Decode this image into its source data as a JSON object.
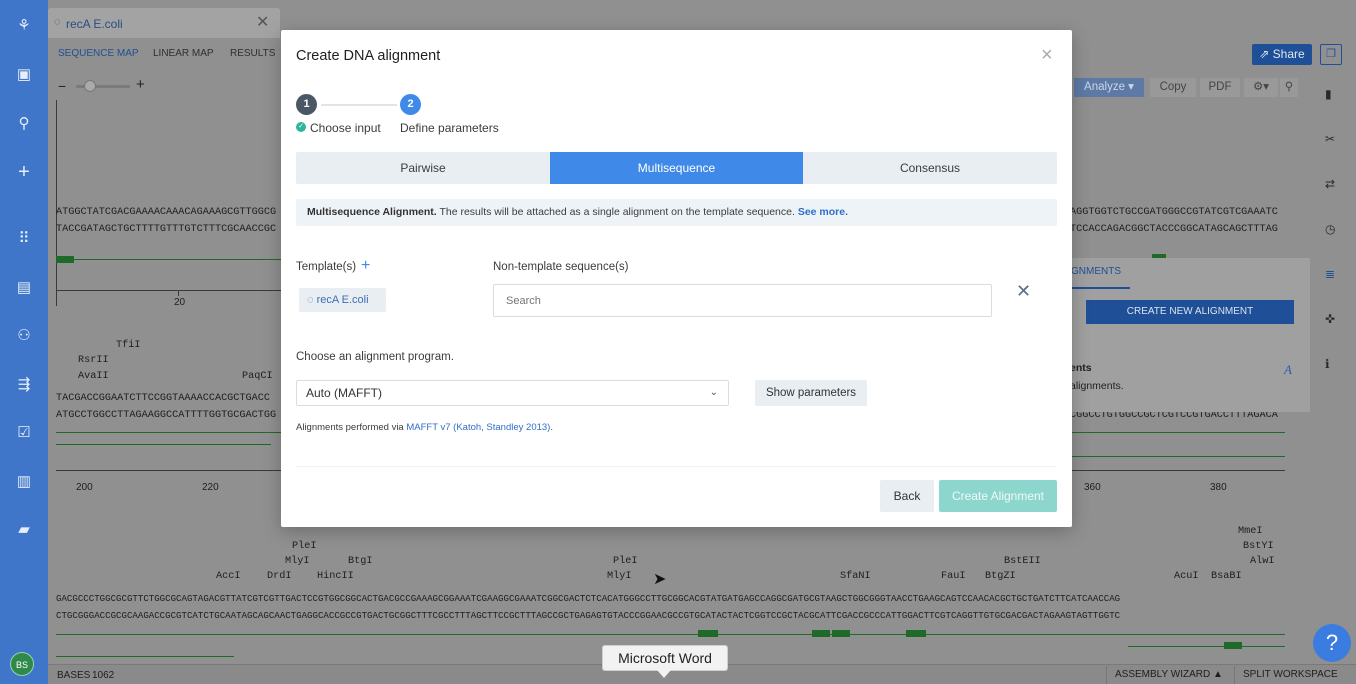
{
  "nav": {
    "avatar": "BS",
    "icons": [
      "jellyfish-logo-icon",
      "briefcase-icon",
      "search-icon",
      "plus-icon",
      "apps-grid-icon",
      "notebook-icon",
      "hierarchy-icon",
      "workflow-icon",
      "clipboard-icon",
      "chart-icon",
      "folder-icon"
    ]
  },
  "document": {
    "tab_title": "recA E.coli",
    "tab_close": "✕",
    "subnav": [
      "SEQUENCE MAP",
      "LINEAR MAP",
      "RESULTS"
    ],
    "share_label": "Share",
    "toolbar": {
      "analyze": "Analyze ▾",
      "copy": "Copy",
      "pdf": "PDF"
    },
    "seq_top_1": "ATGGCTATCGACGAAAACAAACAGAAAGCGTTGGCG",
    "seq_top_2": "TACCGATAGCTGCTTTTGTTTGTCTTTCGCAACCGC",
    "seq_top_r1": "AGGTGGTCTGCCGATGGGCCGTATCGTCGAAATC",
    "seq_top_r2": "TCCACCAGACGGCTACCCGGCATAGCAGCTTTAG",
    "num_20": "20",
    "enz_tfii": "TfiI",
    "enz_rsrii": "RsrII",
    "enz_avaii": "AvaII",
    "enz_paqci": "PaqCI",
    "seq_mid_1": "TACGACCGGAATCTTCCGGTAAAACCACGCTGACC",
    "seq_mid_2": "ATGCCTGGCCTTAGAAGGCCATTTTGGTGCGACTGG",
    "seq_mid_r": "CGGCCTGTGGCCGCTCGTCCGTGACCTTTAGACA",
    "nums_mid": [
      "200",
      "220",
      "360",
      "380"
    ],
    "enz_row1": [
      "PleI"
    ],
    "enz_row2": [
      "MlyI",
      "BtgI",
      "PleI",
      "BstEII",
      "BstYI"
    ],
    "enz_row3": [
      "AccI",
      "DrdI",
      "HincII",
      "MlyI",
      "SfaNI",
      "FauI",
      "BtgZI",
      "AcuI",
      "BsaBI",
      "AlwI"
    ],
    "enz_mmei": "MmeI",
    "seq_bot_1": "GACGCCCTGGCGCGTTCTGGCGCAGTAGACGTTATCGTCGTTGACTCCGTGGCGGCACTGACGCCGAAAGCGGAAATCGAAGGCGAAATCGGCGACTCTCACATGGGCCTTGCGGCACGTATGATGAGCCAGGCGATGCGTAAGCTGGCGGGTAACCTGAAGCAGTCCAACACGCTGCTGATCTTCATCAACCAG",
    "seq_bot_2": "CTGCGGGACCGCGCAAGACCGCGTCATCTGCAATAGCAGCAACTGAGGCACCGCCGTGACTGCGGCTTTCGCCTTTAGCTTCCGCTTTAGCCGCTGAGAGTGTACCCGGAACGCCGTGCATACTACTCGGTCCGCTACGCATTCGACCGCCCATTGGACTTCGTCAGGTTGTGCGACGACTAGAAGTAGTTGGTC",
    "right_panel": {
      "tab": "ALIGNMENTS",
      "create": "CREATE NEW ALIGNMENT",
      "title": "ents",
      "desc": "alignments.",
      "glyph": "A"
    },
    "status": {
      "bases_label": "BASES",
      "bases_count": "1062",
      "assembly": "ASSEMBLY WIZARD ▲",
      "split": "SPLIT WORKSPACE"
    },
    "help": "?"
  },
  "tooltip": "Microsoft Word",
  "modal": {
    "title": "Create DNA alignment",
    "close": "×",
    "steps": [
      {
        "number": "1",
        "label": "Choose input"
      },
      {
        "number": "2",
        "label": "Define parameters"
      }
    ],
    "modes": [
      "Pairwise",
      "Multisequence",
      "Consensus"
    ],
    "active_mode": "Multisequence",
    "info_bold": "Multisequence Alignment.",
    "info_text": " The results will be attached as a single alignment on the template sequence. ",
    "info_link": "See more.",
    "templates_label": "Template(s)",
    "template_chip": "recA E.coli",
    "nontemplate_label": "Non-template sequence(s)",
    "search_placeholder": "Search",
    "program_label": "Choose an alignment program.",
    "program_value": "Auto (MAFFT)",
    "show_params": "Show parameters",
    "note_prefix": "Alignments performed via ",
    "note_link": "MAFFT v7 (Katoh, Standley 2013)",
    "note_suffix": ".",
    "back": "Back",
    "create": "Create Alignment"
  }
}
